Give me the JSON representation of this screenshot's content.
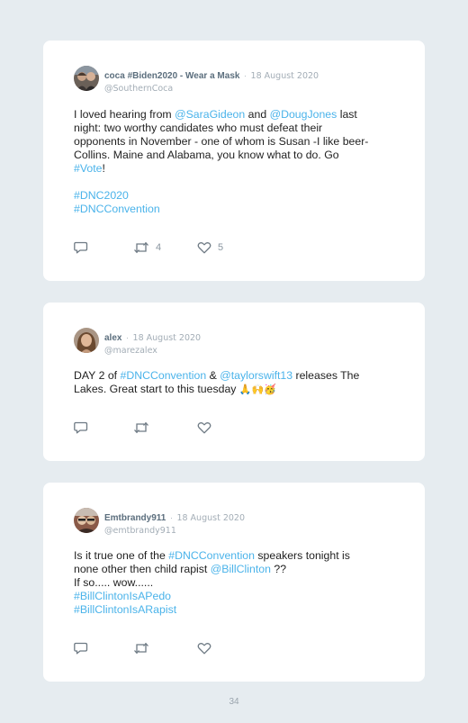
{
  "tweets": [
    {
      "author": "coca #Biden2020 - Wear a Mask",
      "separator": "·",
      "date": "18 August 2020",
      "handle": "@SouthernCoca",
      "lines": [
        [
          {
            "t": "I loved hearing from "
          },
          {
            "t": "@SaraGideon",
            "link": true
          },
          {
            "t": " and "
          },
          {
            "t": "@DougJones",
            "link": true
          },
          {
            "t": " last"
          }
        ],
        [
          {
            "t": "night: two worthy candidates who must defeat their"
          }
        ],
        [
          {
            "t": "opponents in November - one of whom is Susan -I like beer-"
          }
        ],
        [
          {
            "t": "Collins. Maine and Alabama, you know what to do. Go"
          }
        ],
        [
          {
            "t": "#Vote",
            "link": true
          },
          {
            "t": "!"
          }
        ],
        [],
        [
          {
            "t": "#DNC2020",
            "link": true
          }
        ],
        [
          {
            "t": "#DNCConvention",
            "link": true
          }
        ]
      ],
      "retweets": "4",
      "likes": "5"
    },
    {
      "author": "alex",
      "separator": "·",
      "date": "18 August 2020",
      "handle": "@marezalex",
      "lines": [
        [
          {
            "t": "DAY 2 of "
          },
          {
            "t": "#DNCConvention",
            "link": true
          },
          {
            "t": " & "
          },
          {
            "t": "@taylorswift13",
            "link": true
          },
          {
            "t": " releases The"
          }
        ],
        [
          {
            "t": "Lakes. Great start to this tuesday "
          },
          {
            "t": "🙏🙌🥳",
            "emoji": true
          }
        ]
      ],
      "retweets": "",
      "likes": ""
    },
    {
      "author": "Emtbrandy911",
      "separator": "·",
      "date": "18 August 2020",
      "handle": "@emtbrandy911",
      "lines": [
        [
          {
            "t": "Is it true one of the "
          },
          {
            "t": "#DNCConvention",
            "link": true
          },
          {
            "t": " speakers tonight is"
          }
        ],
        [
          {
            "t": "none other then child rapist "
          },
          {
            "t": "@BillClinton",
            "link": true
          },
          {
            "t": " ??"
          }
        ],
        [
          {
            "t": "If so..... wow......"
          }
        ],
        [
          {
            "t": "#BillClintonIsAPedo",
            "link": true
          }
        ],
        [
          {
            "t": "#BillClintonIsARapist",
            "link": true
          }
        ]
      ],
      "retweets": "",
      "likes": ""
    }
  ],
  "page_number": "34",
  "colors": {
    "background": "#e6ecf0",
    "card": "#ffffff",
    "link": "#4ab3ea",
    "text": "#1f1f1f",
    "muted": "#a3adb6",
    "icon": "#6e7a84"
  },
  "icons": {
    "reply": "reply-icon",
    "retweet": "retweet-icon",
    "like": "heart-icon"
  }
}
